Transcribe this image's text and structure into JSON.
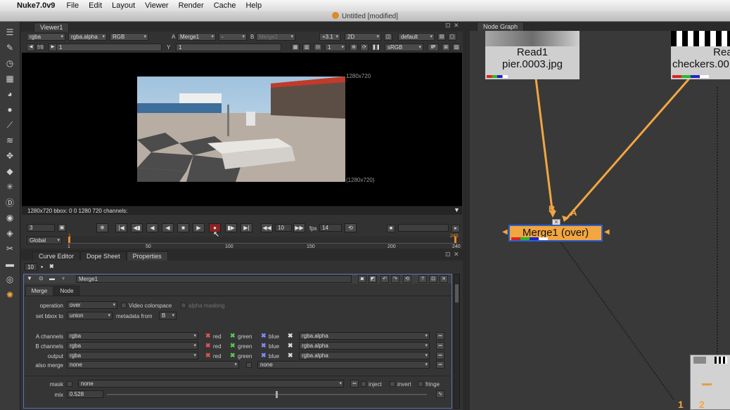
{
  "menubar": {
    "app": "Nuke7.0v9",
    "items": [
      "File",
      "Edit",
      "Layout",
      "Viewer",
      "Render",
      "Cache",
      "Help"
    ]
  },
  "window": {
    "title": "Untitled [modified]"
  },
  "viewer": {
    "tab": "Viewer1",
    "channels": "rgba",
    "alpha": "rgba.alpha",
    "colorspace": "RGB",
    "a_label": "A",
    "a_input": "Merge1",
    "compare": "-",
    "b_label": "B",
    "b_input": "Merge1",
    "gain": "+3.1",
    "view_mode": "2D",
    "lut": "default",
    "fstop": "f/8",
    "frame_step": "1",
    "gamma_label": "Y",
    "gamma": "1",
    "proxy": "1",
    "display": "sRGB",
    "ip": "IP",
    "format_label_top": "1280x720",
    "format_label_bottom": "(1280x720)",
    "status": "1280x720 bbox: 0 0 1280 720 channels:"
  },
  "timeline": {
    "frame": "3",
    "increment": "10",
    "fps_label": "fps",
    "fps": "14",
    "scope": "Global",
    "ticks": [
      "1",
      "50",
      "100",
      "150",
      "200",
      "240"
    ],
    "in_marker": "1",
    "out_marker": "240"
  },
  "properties": {
    "tabs": [
      "Curve Editor",
      "Dope Sheet",
      "Properties"
    ],
    "max_panels": "10",
    "node_name": "Merge1",
    "subtabs": [
      "Merge",
      "Node"
    ],
    "operation_label": "operation",
    "operation": "over",
    "video_colorspace": "Video colorspace",
    "alpha_masking": "alpha masking",
    "set_bbox_label": "set bbox to",
    "set_bbox": "union",
    "metadata_label": "metadata from",
    "metadata": "B",
    "rows": [
      {
        "label": "A channels",
        "value": "rgba",
        "alpha": "rgba.alpha"
      },
      {
        "label": "B channels",
        "value": "rgba",
        "alpha": "rgba.alpha"
      },
      {
        "label": "output",
        "value": "rgba",
        "alpha": "rgba.alpha"
      }
    ],
    "ch_red": "red",
    "ch_green": "green",
    "ch_blue": "blue",
    "also_merge_label": "also merge",
    "also_merge": "none",
    "also_merge2": "none",
    "mask_label": "mask",
    "mask": "none",
    "inject": "inject",
    "invert": "invert",
    "fringe": "fringe",
    "mix_label": "mix",
    "mix": "0.528"
  },
  "nodegraph": {
    "tab": "Node Graph",
    "read1_title": "Read1",
    "read1_file": "pier.0003.jpg",
    "read2_title": "Read",
    "read2_file": "checkers.00",
    "merge_label": "Merge1 (over)",
    "input_b": "B",
    "input_a": "A",
    "backdrop_num1": "1",
    "backdrop_num2": "2"
  },
  "colors": {
    "node_orange": "#f2a641",
    "pipe": "#e8a33c",
    "selected_border": "#2f5fcc"
  }
}
